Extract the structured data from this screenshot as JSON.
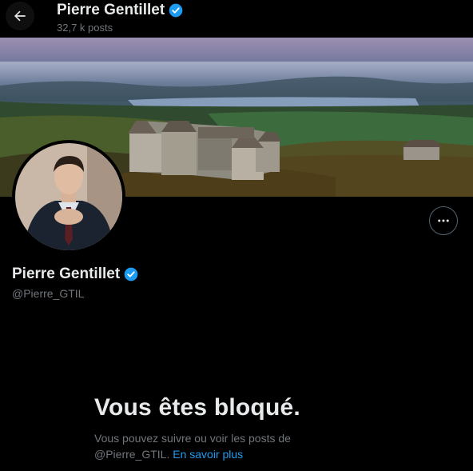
{
  "header": {
    "name": "Pierre Gentillet",
    "post_count": "32,7 k posts"
  },
  "profile": {
    "name": "Pierre Gentillet",
    "handle": "@Pierre_GTIL",
    "verified": true
  },
  "blocked": {
    "title": "Vous êtes bloqué.",
    "description": "Vous pouvez suivre ou voir les posts de @Pierre_GTIL.",
    "link_label": "En savoir plus"
  },
  "colors": {
    "background": "#000000",
    "text_primary": "#e7e9ea",
    "text_secondary": "#71767b",
    "accent": "#1d9bf0"
  },
  "icons": {
    "back": "arrow-left-icon",
    "verified": "verified-badge-icon",
    "more": "more-horizontal-icon"
  }
}
